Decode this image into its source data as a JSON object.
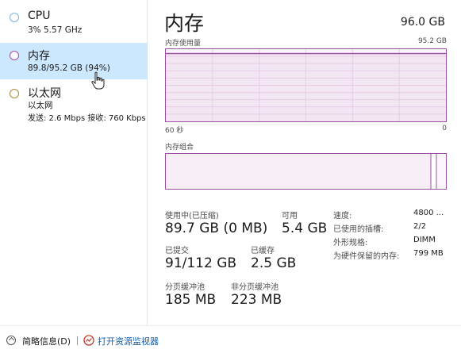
{
  "sidebar": {
    "items": [
      {
        "title": "CPU",
        "sub1": "3% 5.57 GHz",
        "sub2": "",
        "dot_color": "#7ab3df"
      },
      {
        "title": "内存",
        "sub1": "89.8/95.2 GB (94%)",
        "sub2": "",
        "dot_color": "#9b4fa0"
      },
      {
        "title": "以太网",
        "sub1": "以太网",
        "sub2": "发送: 2.6 Mbps  接收: 760 Kbps",
        "dot_color": "#a88a33"
      }
    ],
    "selected_index": 1
  },
  "main": {
    "title": "内存",
    "capacity": "96.0 GB",
    "usage_graph": {
      "label": "内存使用量",
      "max_label": "95.2 GB",
      "time_label": "60 秒",
      "min_label": "0",
      "fill_fraction": 0.94
    },
    "composition_graph": {
      "label": "内存组合"
    },
    "stats": {
      "in_use_label": "使用中(已压缩)",
      "in_use_value": "89.7 GB (0 MB)",
      "available_label": "可用",
      "available_value": "5.4 GB",
      "committed_label": "已提交",
      "committed_value": "91/112 GB",
      "cached_label": "已缓存",
      "cached_value": "2.5 GB",
      "paged_label": "分页缓冲池",
      "paged_value": "185 MB",
      "nonpaged_label": "非分页缓冲池",
      "nonpaged_value": "223 MB"
    },
    "specs": [
      {
        "key": "速度:",
        "value": "4800 ..."
      },
      {
        "key": "已使用的插槽:",
        "value": "2/2"
      },
      {
        "key": "外形规格:",
        "value": "DIMM"
      },
      {
        "key": "为硬件保留的内存:",
        "value": "799 MB"
      }
    ]
  },
  "footer": {
    "brief_label": "简略信息(D)",
    "monitor_label": "打开资源监视器"
  },
  "colors": {
    "selected_bg": "#cce8ff",
    "memory_accent": "#9b4fa0",
    "link": "#0a5fb4"
  }
}
